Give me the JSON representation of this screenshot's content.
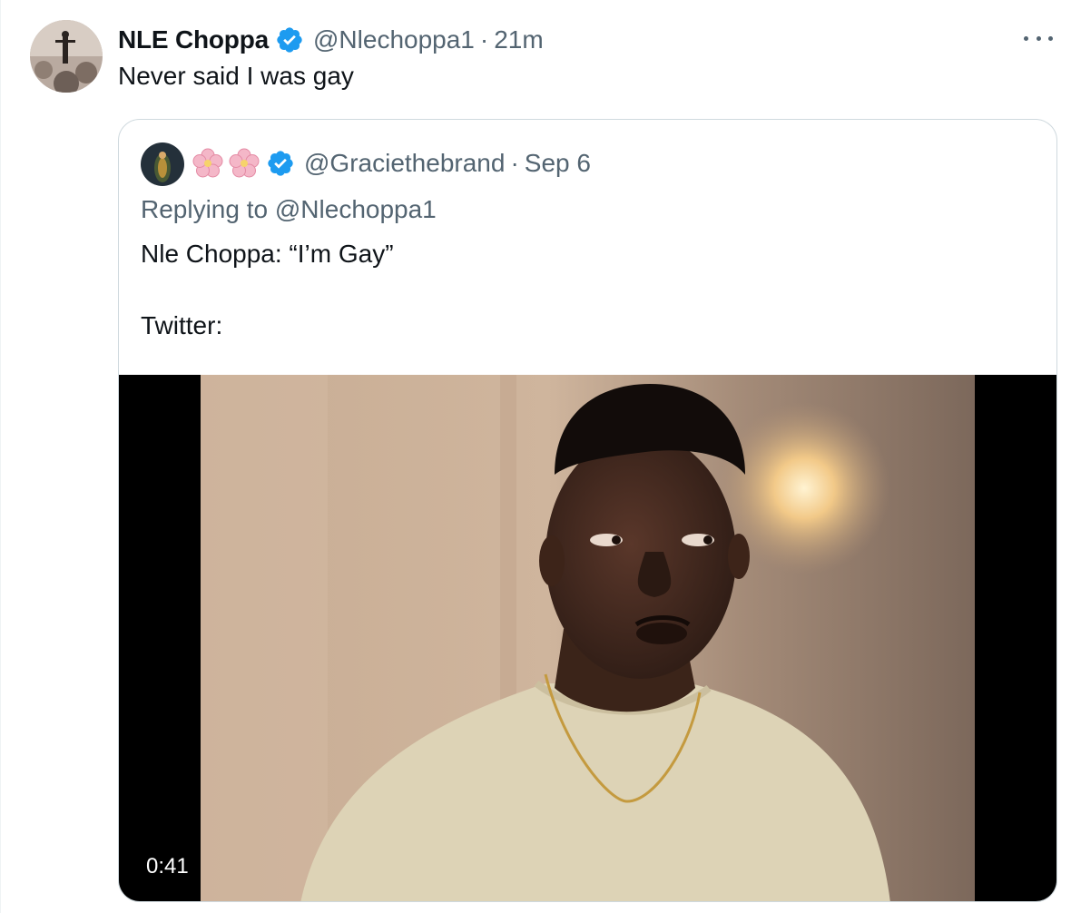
{
  "tweet": {
    "display_name": "NLE Choppa",
    "handle": "@Nlechoppa1",
    "separator": "·",
    "time": "21m",
    "text": "Never said I was gay",
    "verified_icon": "verified-badge-icon",
    "more_icon": "more-horizontal-icon"
  },
  "quoted_tweet": {
    "handle": "@Graciethebrand",
    "separator": "·",
    "time": "Sep 6",
    "name_icons": [
      "cherry-blossom-icon",
      "cherry-blossom-icon"
    ],
    "replying_label": "Replying to",
    "replying_user": "@Nlechoppa1",
    "line1": "Nle Choppa: “I’m Gay”",
    "line2": "Twitter:",
    "video": {
      "duration": "0:41"
    }
  },
  "colors": {
    "text_primary": "#0f1419",
    "text_secondary": "#536471",
    "verified_blue": "#1d9bf0",
    "border": "#cfd9de"
  }
}
